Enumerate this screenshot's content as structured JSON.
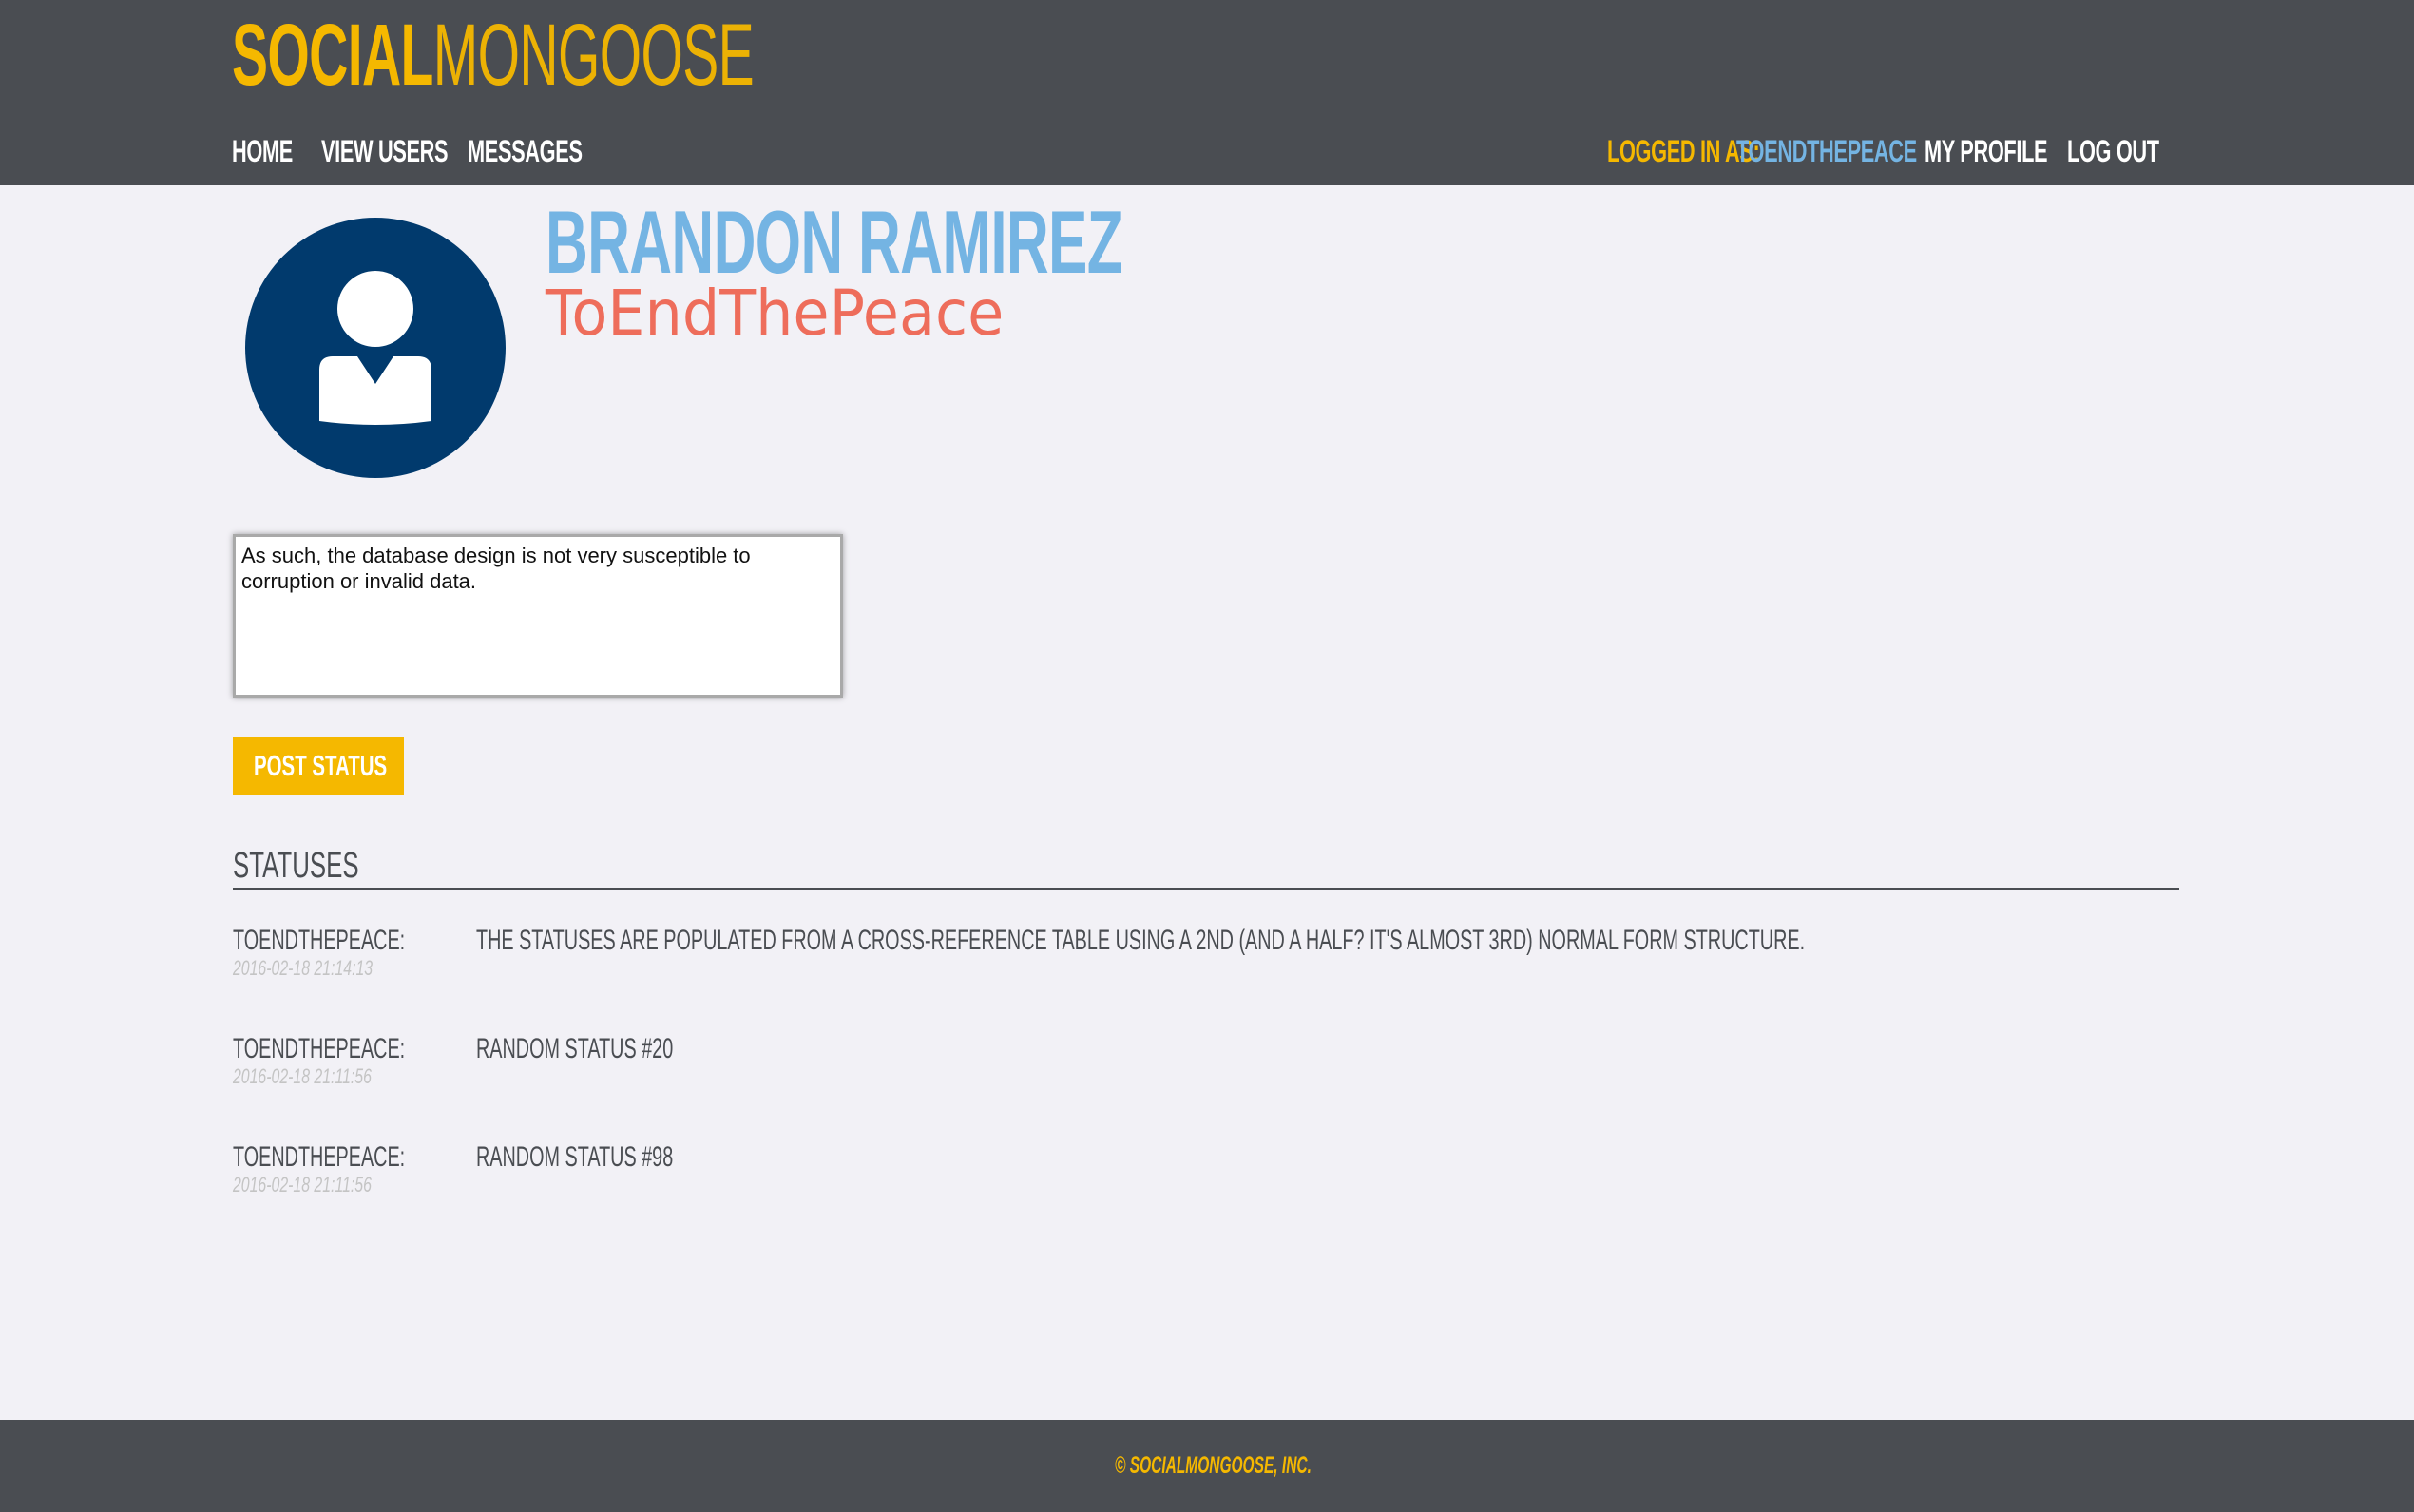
{
  "brand": {
    "part1": "SOCIAL",
    "part2": "MONGOOSE",
    "color": "#f5b800"
  },
  "nav": {
    "home": "HOME",
    "view_users": "VIEW USERS",
    "messages": "MESSAGES",
    "logged_in_label": "LOGGED IN AS:",
    "logged_in_user": "TOENDTHEPEACE",
    "my_profile": "MY PROFILE",
    "log_out": "LOG OUT"
  },
  "profile": {
    "name": "BRANDON RAMIREZ",
    "handle": "ToEndThePeace",
    "avatar_icon": "user-avatar-icon"
  },
  "status_form": {
    "value": "As such, the database design is not very susceptible to corruption or invalid data.",
    "button_label": "POST STATUS"
  },
  "statuses": {
    "title": "STATUSES",
    "items": [
      {
        "user": "TOENDTHEPEACE:",
        "time": "2016-02-18 21:14:13",
        "text": "THE STATUSES ARE POPULATED FROM A CROSS-REFERENCE TABLE USING A 2ND (AND A HALF? IT'S ALMOST 3RD) NORMAL FORM STRUCTURE."
      },
      {
        "user": "TOENDTHEPEACE:",
        "time": "2016-02-18 21:11:56",
        "text": "RANDOM STATUS #20"
      },
      {
        "user": "TOENDTHEPEACE:",
        "time": "2016-02-18 21:11:56",
        "text": "RANDOM STATUS #98"
      }
    ]
  },
  "footer": {
    "text": "© SOCIALMONGOOSE, INC."
  },
  "colors": {
    "header_bg": "#4a4d52",
    "page_bg": "#f2f1f6",
    "accent_yellow": "#f5b800",
    "accent_blue": "#74b4e3",
    "accent_red": "#ee6d5b",
    "avatar_bg": "#013a6d"
  }
}
